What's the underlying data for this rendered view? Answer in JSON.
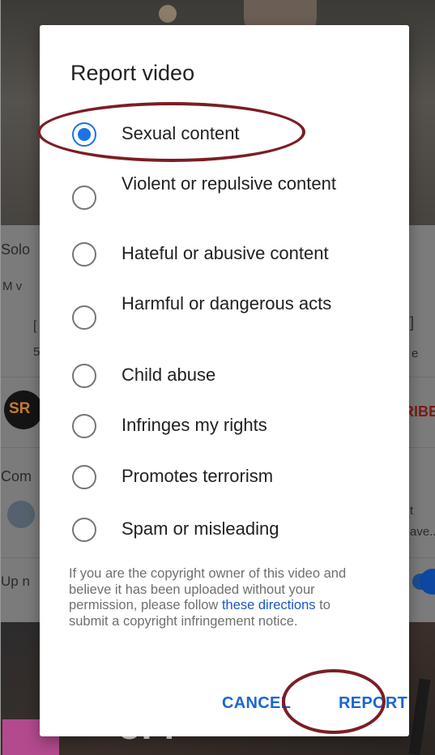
{
  "background": {
    "channel_initials": "SR",
    "subscribe_fragment": "RIBE",
    "text_fragments": [
      "Solo",
      "M v",
      "[",
      "5",
      "]",
      "e",
      "Com",
      "t",
      "ave...",
      "Up n"
    ],
    "thumbnail_fragment": "UP!"
  },
  "dialog": {
    "title": "Report video",
    "options": [
      {
        "label": "Sexual content",
        "selected": true
      },
      {
        "label": "Violent or repulsive content",
        "selected": false
      },
      {
        "label": "Hateful or abusive content",
        "selected": false
      },
      {
        "label": "Harmful or dangerous acts",
        "selected": false
      },
      {
        "label": "Child abuse",
        "selected": false
      },
      {
        "label": "Infringes my rights",
        "selected": false
      },
      {
        "label": "Promotes terrorism",
        "selected": false
      },
      {
        "label": "Spam or misleading",
        "selected": false
      }
    ],
    "note": {
      "before_link": "If you are the copyright owner of this video and believe it has been uploaded without your permission, please follow",
      "link_text": "these directions",
      "after_link": "to submit a copyright infringement notice."
    },
    "cancel_label": "CANCEL",
    "report_label": "REPORT"
  },
  "colors": {
    "accent": "#1a73e8",
    "annotation": "#7b1e24"
  }
}
